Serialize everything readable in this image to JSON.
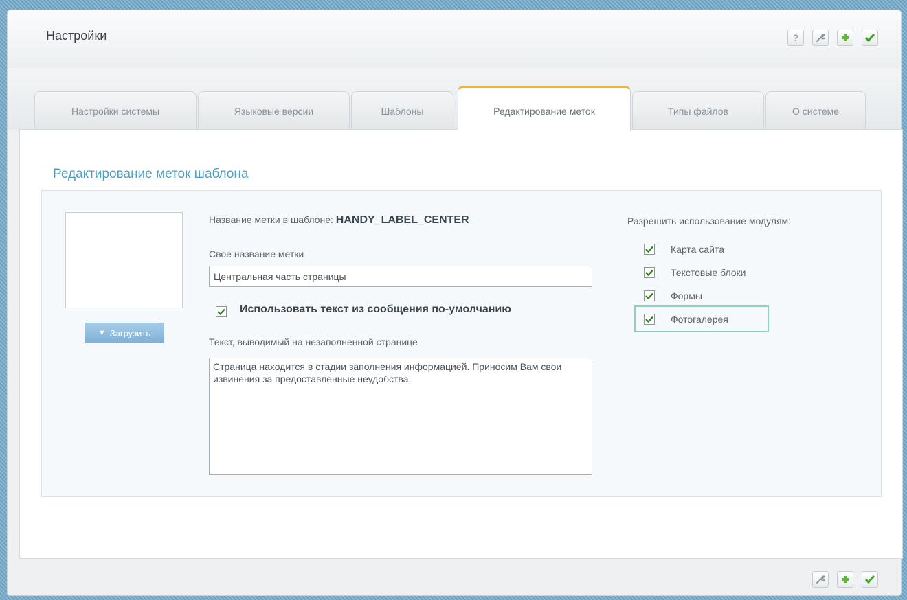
{
  "app": {
    "title": "Настройки"
  },
  "toolbar": {
    "help_icon": "help-icon",
    "settings_icon": "wrench-icon",
    "add_icon": "plus-icon",
    "apply_icon": "check-icon"
  },
  "tabs": [
    {
      "label": "Настройки системы",
      "active": false
    },
    {
      "label": "Языковые версии",
      "active": false
    },
    {
      "label": "Шаблоны",
      "active": false
    },
    {
      "label": "Редактирование меток",
      "active": true
    },
    {
      "label": "Типы файлов",
      "active": false
    },
    {
      "label": "О системе",
      "active": false
    }
  ],
  "section": {
    "title": "Редактирование меток шаблона"
  },
  "form": {
    "label_name_caption": "Название метки в шаблоне:",
    "label_name_value": "HANDY_LABEL_CENTER",
    "own_name_caption": "Свое название метки",
    "own_name_value": "Центральная часть страницы",
    "use_default_text_label": "Использовать текст из сообщения по-умолчанию",
    "use_default_text_checked": true,
    "empty_page_text_caption": "Текст, выводимый на незаполненной странице",
    "empty_page_text_value": "Страница находится в стадии заполнения информацией. Приносим Вам свои извинения за предоставленные неудобства.",
    "upload_label": "Загрузить"
  },
  "modules": {
    "caption": "Разрешить использование модулям:",
    "items": [
      {
        "label": "Карта сайта",
        "checked": true
      },
      {
        "label": "Текстовые блоки",
        "checked": true
      },
      {
        "label": "Формы",
        "checked": true
      },
      {
        "label": "Фотогалерея",
        "checked": true
      }
    ]
  },
  "colors": {
    "accent": "#4a9ec0",
    "active_tab_border": "#f3b52c",
    "add_green": "#5cb82e",
    "check_green": "#3aa51e",
    "highlight": "#8ed3c2"
  }
}
